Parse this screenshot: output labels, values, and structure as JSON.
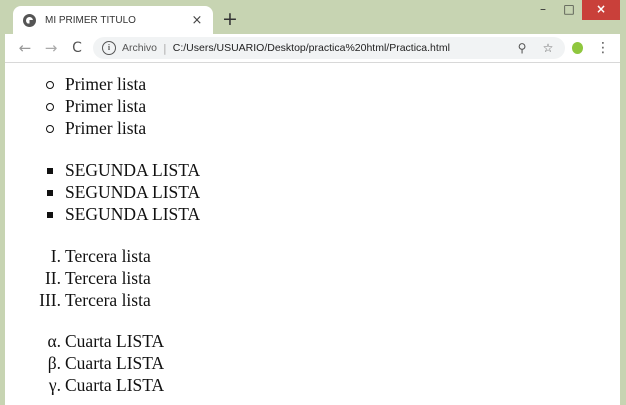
{
  "tab": {
    "title": "MI PRIMER TITULO",
    "close_glyph": "×",
    "new_tab_glyph": "+"
  },
  "window_controls": {
    "minimize": "–",
    "maximize": "□",
    "close": "×"
  },
  "toolbar": {
    "back_glyph": "←",
    "forward_glyph": "→",
    "reload_glyph": "C",
    "info_glyph": "i",
    "archivo_label": "Archivo",
    "separator": "|",
    "url": "C:/Users/USUARIO/Desktop/practica%20html/Practica.html",
    "zoom_glyph": "⚲",
    "star_glyph": "☆",
    "menu_glyph": "⋮"
  },
  "lists": {
    "circle": [
      "Primer lista",
      "Primer lista",
      "Primer lista"
    ],
    "square": [
      "SEGUNDA LISTA",
      "SEGUNDA LISTA",
      "SEGUNDA LISTA"
    ],
    "roman": {
      "markers": [
        "I.",
        "II.",
        "III."
      ],
      "items": [
        "Tercera lista",
        "Tercera lista",
        "Tercera lista"
      ]
    },
    "greek": {
      "markers": [
        "α.",
        "β.",
        "γ."
      ],
      "items": [
        "Cuarta LISTA",
        "Cuarta LISTA",
        "Cuarta LISTA"
      ]
    }
  },
  "colors": {
    "window_frame": "#c7d4b2",
    "close_button": "#c9403a",
    "extension": "#8fc73e"
  }
}
